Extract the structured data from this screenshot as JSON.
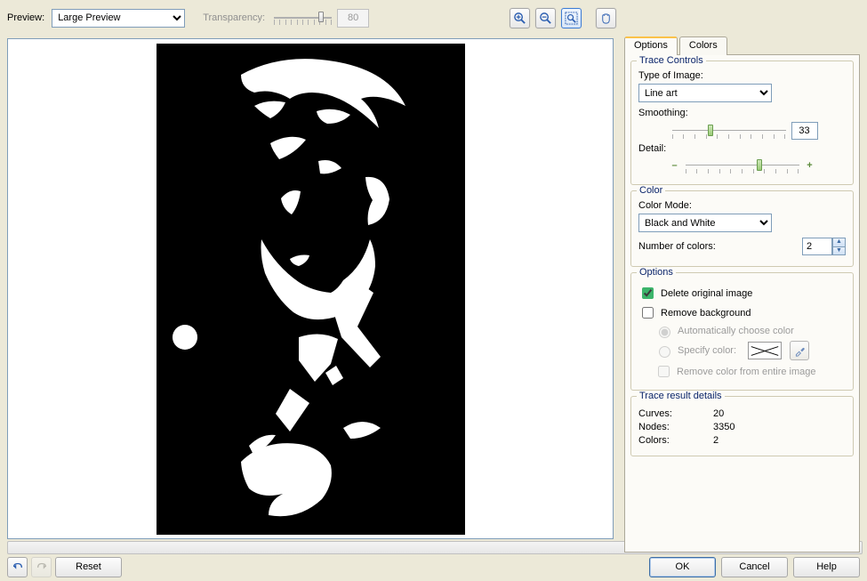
{
  "topbar": {
    "previewLabel": "Preview:",
    "previewSelect": "Large Preview",
    "transparencyLabel": "Transparency:",
    "transparencyValue": "80",
    "tools": {
      "zoomIn": "zoom-in",
      "zoomOut": "zoom-out",
      "zoomFit": "zoom-fit",
      "pan": "pan"
    }
  },
  "sidebar": {
    "tabOptions": "Options",
    "tabColors": "Colors",
    "traceControls": {
      "title": "Trace Controls",
      "typeOfImageLabel": "Type of Image:",
      "typeOfImageValue": "Line art",
      "smoothingLabel": "Smoothing:",
      "smoothingValue": "33",
      "detailLabel": "Detail:"
    },
    "color": {
      "title": "Color",
      "modeLabel": "Color Mode:",
      "modeValue": "Black and White",
      "numColorsLabel": "Number of colors:",
      "numColorsValue": "2"
    },
    "options": {
      "title": "Options",
      "deleteOriginal": "Delete original image",
      "removeBackground": "Remove background",
      "autoChoose": "Automatically choose color",
      "specifyColor": "Specify color:",
      "removeFromEntire": "Remove color from entire image"
    },
    "results": {
      "title": "Trace result details",
      "curvesLabel": "Curves:",
      "curvesValue": "20",
      "nodesLabel": "Nodes:",
      "nodesValue": "3350",
      "colorsLabel": "Colors:",
      "colorsValue": "2"
    }
  },
  "buttons": {
    "reset": "Reset",
    "ok": "OK",
    "cancel": "Cancel",
    "help": "Help"
  }
}
